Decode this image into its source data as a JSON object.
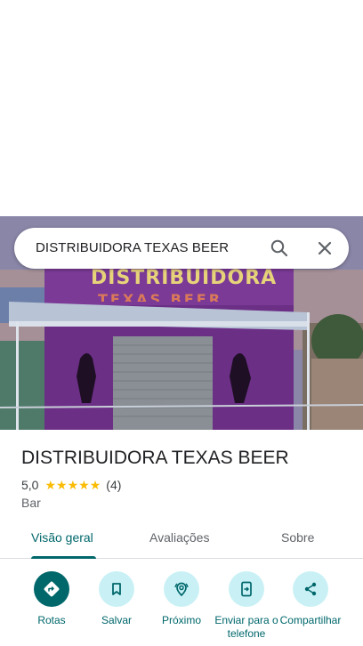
{
  "search": {
    "query": "DISTRIBUIDORA TEXAS BEER"
  },
  "place": {
    "name": "DISTRIBUIDORA TEXAS BEER",
    "rating": "5,0",
    "stars": 5,
    "review_count": "(4)",
    "category": "Bar"
  },
  "photo": {
    "sign_text": "DISTRIBUIDORA",
    "sign_text_2": "TEXAS BEER"
  },
  "tabs": [
    {
      "label": "Visão geral",
      "active": true
    },
    {
      "label": "Avaliações",
      "active": false
    },
    {
      "label": "Sobre",
      "active": false
    }
  ],
  "actions": [
    {
      "label": "Rotas",
      "icon": "directions-icon"
    },
    {
      "label": "Salvar",
      "icon": "bookmark-icon"
    },
    {
      "label": "Próximo",
      "icon": "nearby-icon"
    },
    {
      "label": "Enviar para o telefone",
      "icon": "send-to-phone-icon"
    },
    {
      "label": "Compartilhar",
      "icon": "share-icon"
    }
  ],
  "colors": {
    "accent": "#00676b",
    "accent_light": "#c9f1f5",
    "star": "#fbbc04"
  }
}
